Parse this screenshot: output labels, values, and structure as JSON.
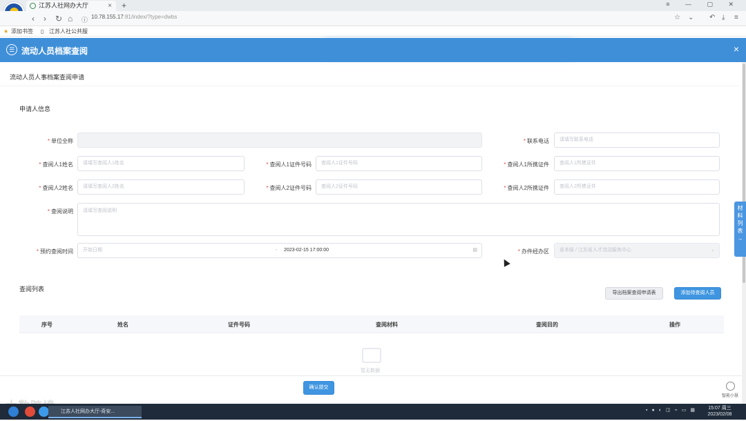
{
  "browser": {
    "tab_title": "江苏人社网办大厅",
    "new_tab": "+",
    "url_host": "10.78.155.17",
    "url_rest": ":81/index/?type=dwbs",
    "bookmark_add": "添加书签",
    "bookmark_1": "江苏人社公共服"
  },
  "dialog": {
    "title": "流动人员档案查阅",
    "close": "×"
  },
  "page": {
    "subtitle": "流动人员人事档案查阅申请",
    "section_applicant": "申请人信息",
    "section_list": "查阅列表"
  },
  "form": {
    "unit_name_label": "单位全称",
    "phone_label": "联系电话",
    "phone_placeholder": "请填写联系电话",
    "p1_name_label": "查阅人1姓名",
    "p1_name_placeholder": "请填写查阅人1姓名",
    "p1_id_label": "查阅人1证件号码",
    "p1_id_placeholder": "查阅人1证件号码",
    "p1_cert_label": "查阅人1所携证件",
    "p1_cert_placeholder": "查阅人1所携证件",
    "p2_name_label": "查阅人2姓名",
    "p2_name_placeholder": "请填写查阅人2姓名",
    "p2_id_label": "查阅人2证件号码",
    "p2_id_placeholder": "查阅人2证件号码",
    "p2_cert_label": "查阅人2所携证件",
    "p2_cert_placeholder": "查阅人2所携证件",
    "desc_label": "查阅说明",
    "desc_placeholder": "请填写查阅说明",
    "time_label": "预约查阅时间",
    "time_start_placeholder": "开始日期",
    "time_end_value": "2023-02-15 17:00:00",
    "office_label": "办件经办区",
    "office_value": "省本级 / 江苏省人才流动服务中心"
  },
  "side_tab": [
    "材",
    "料",
    "列",
    "表",
    "→"
  ],
  "list": {
    "export_button": "导出档案查阅申请表",
    "add_button": "添加待查阅人员",
    "columns": [
      "序号",
      "姓名",
      "证件号码",
      "查阅材料",
      "查阅目的",
      "操作"
    ],
    "empty_text": "暂无数据"
  },
  "footer": {
    "submit_button": "确认提交",
    "assistant_label": "智能小慧",
    "watermark": "大数跨境"
  },
  "taskbar": {
    "window_title": "江苏人社网办大厅-奇安...",
    "time": "15:07 周三",
    "date": "2023/02/08"
  }
}
